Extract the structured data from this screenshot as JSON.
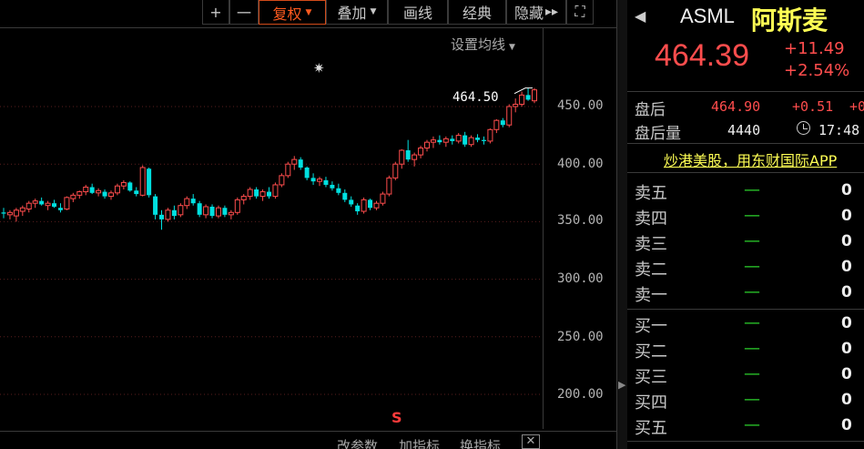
{
  "toolbar": {
    "zoom_in": "+",
    "zoom_out": "一",
    "adjust_label": "复权",
    "overlay_label": "叠加",
    "draw_label": "画线",
    "classic_label": "经典",
    "hide_label": "隐藏",
    "hide_arrows": "▸▸",
    "fullscreen_icon": "⛶"
  },
  "chart": {
    "ma_setting": "设置均线",
    "last_price_label": "464.50",
    "y_ticks": [
      "450.00",
      "400.00",
      "350.00",
      "300.00",
      "250.00",
      "200.00"
    ],
    "s_marker": "S",
    "up_color": "#ff4d4d",
    "down_color": "#00e0e0"
  },
  "chart_data": {
    "type": "candlestick",
    "ylim": [
      180,
      480
    ],
    "candles": [
      {
        "o": 358,
        "h": 362,
        "l": 353,
        "c": 357
      },
      {
        "o": 356,
        "h": 360,
        "l": 352,
        "c": 358
      },
      {
        "o": 355,
        "h": 362,
        "l": 350,
        "c": 360
      },
      {
        "o": 359,
        "h": 364,
        "l": 355,
        "c": 362
      },
      {
        "o": 361,
        "h": 368,
        "l": 358,
        "c": 366
      },
      {
        "o": 366,
        "h": 370,
        "l": 362,
        "c": 368
      },
      {
        "o": 368,
        "h": 371,
        "l": 364,
        "c": 365
      },
      {
        "o": 364,
        "h": 368,
        "l": 360,
        "c": 366
      },
      {
        "o": 366,
        "h": 369,
        "l": 362,
        "c": 363
      },
      {
        "o": 362,
        "h": 366,
        "l": 358,
        "c": 360
      },
      {
        "o": 361,
        "h": 372,
        "l": 360,
        "c": 371
      },
      {
        "o": 370,
        "h": 375,
        "l": 367,
        "c": 373
      },
      {
        "o": 373,
        "h": 377,
        "l": 370,
        "c": 376
      },
      {
        "o": 376,
        "h": 382,
        "l": 373,
        "c": 380
      },
      {
        "o": 380,
        "h": 383,
        "l": 374,
        "c": 375
      },
      {
        "o": 375,
        "h": 379,
        "l": 372,
        "c": 377
      },
      {
        "o": 376,
        "h": 378,
        "l": 370,
        "c": 372
      },
      {
        "o": 372,
        "h": 377,
        "l": 369,
        "c": 375
      },
      {
        "o": 375,
        "h": 383,
        "l": 373,
        "c": 381
      },
      {
        "o": 381,
        "h": 386,
        "l": 378,
        "c": 384
      },
      {
        "o": 384,
        "h": 385,
        "l": 376,
        "c": 377
      },
      {
        "o": 377,
        "h": 380,
        "l": 372,
        "c": 374
      },
      {
        "o": 373,
        "h": 399,
        "l": 372,
        "c": 397
      },
      {
        "o": 396,
        "h": 397,
        "l": 371,
        "c": 373
      },
      {
        "o": 372,
        "h": 374,
        "l": 352,
        "c": 356
      },
      {
        "o": 356,
        "h": 360,
        "l": 343,
        "c": 352
      },
      {
        "o": 352,
        "h": 362,
        "l": 350,
        "c": 360
      },
      {
        "o": 360,
        "h": 364,
        "l": 352,
        "c": 355
      },
      {
        "o": 356,
        "h": 366,
        "l": 354,
        "c": 364
      },
      {
        "o": 364,
        "h": 372,
        "l": 361,
        "c": 370
      },
      {
        "o": 370,
        "h": 374,
        "l": 364,
        "c": 366
      },
      {
        "o": 366,
        "h": 368,
        "l": 354,
        "c": 356
      },
      {
        "o": 356,
        "h": 365,
        "l": 353,
        "c": 363
      },
      {
        "o": 363,
        "h": 365,
        "l": 353,
        "c": 355
      },
      {
        "o": 355,
        "h": 364,
        "l": 353,
        "c": 362
      },
      {
        "o": 362,
        "h": 364,
        "l": 354,
        "c": 356
      },
      {
        "o": 356,
        "h": 360,
        "l": 352,
        "c": 358
      },
      {
        "o": 358,
        "h": 371,
        "l": 356,
        "c": 369
      },
      {
        "o": 369,
        "h": 374,
        "l": 365,
        "c": 372
      },
      {
        "o": 372,
        "h": 380,
        "l": 369,
        "c": 378
      },
      {
        "o": 378,
        "h": 380,
        "l": 370,
        "c": 372
      },
      {
        "o": 372,
        "h": 378,
        "l": 368,
        "c": 376
      },
      {
        "o": 376,
        "h": 380,
        "l": 370,
        "c": 372
      },
      {
        "o": 372,
        "h": 384,
        "l": 370,
        "c": 382
      },
      {
        "o": 382,
        "h": 392,
        "l": 380,
        "c": 390
      },
      {
        "o": 390,
        "h": 402,
        "l": 388,
        "c": 400
      },
      {
        "o": 400,
        "h": 407,
        "l": 395,
        "c": 404
      },
      {
        "o": 404,
        "h": 406,
        "l": 395,
        "c": 397
      },
      {
        "o": 397,
        "h": 398,
        "l": 386,
        "c": 388
      },
      {
        "o": 388,
        "h": 392,
        "l": 382,
        "c": 385
      },
      {
        "o": 385,
        "h": 389,
        "l": 381,
        "c": 387
      },
      {
        "o": 386,
        "h": 389,
        "l": 380,
        "c": 382
      },
      {
        "o": 382,
        "h": 385,
        "l": 377,
        "c": 379
      },
      {
        "o": 379,
        "h": 383,
        "l": 373,
        "c": 375
      },
      {
        "o": 375,
        "h": 378,
        "l": 367,
        "c": 369
      },
      {
        "o": 369,
        "h": 372,
        "l": 363,
        "c": 365
      },
      {
        "o": 364,
        "h": 366,
        "l": 356,
        "c": 359
      },
      {
        "o": 359,
        "h": 371,
        "l": 357,
        "c": 369
      },
      {
        "o": 369,
        "h": 370,
        "l": 360,
        "c": 362
      },
      {
        "o": 362,
        "h": 368,
        "l": 360,
        "c": 366
      },
      {
        "o": 366,
        "h": 376,
        "l": 364,
        "c": 374
      },
      {
        "o": 374,
        "h": 390,
        "l": 372,
        "c": 388
      },
      {
        "o": 388,
        "h": 402,
        "l": 386,
        "c": 400
      },
      {
        "o": 400,
        "h": 413,
        "l": 396,
        "c": 412
      },
      {
        "o": 412,
        "h": 421,
        "l": 402,
        "c": 404
      },
      {
        "o": 404,
        "h": 410,
        "l": 398,
        "c": 408
      },
      {
        "o": 408,
        "h": 416,
        "l": 405,
        "c": 414
      },
      {
        "o": 414,
        "h": 421,
        "l": 411,
        "c": 419
      },
      {
        "o": 419,
        "h": 424,
        "l": 414,
        "c": 421
      },
      {
        "o": 421,
        "h": 425,
        "l": 417,
        "c": 419
      },
      {
        "o": 419,
        "h": 424,
        "l": 415,
        "c": 422
      },
      {
        "o": 422,
        "h": 425,
        "l": 417,
        "c": 420
      },
      {
        "o": 420,
        "h": 427,
        "l": 418,
        "c": 425
      },
      {
        "o": 425,
        "h": 428,
        "l": 415,
        "c": 417
      },
      {
        "o": 417,
        "h": 425,
        "l": 415,
        "c": 423
      },
      {
        "o": 423,
        "h": 426,
        "l": 419,
        "c": 421
      },
      {
        "o": 421,
        "h": 424,
        "l": 417,
        "c": 420
      },
      {
        "o": 420,
        "h": 431,
        "l": 418,
        "c": 430
      },
      {
        "o": 430,
        "h": 439,
        "l": 427,
        "c": 438
      },
      {
        "o": 438,
        "h": 440,
        "l": 432,
        "c": 434
      },
      {
        "o": 434,
        "h": 452,
        "l": 432,
        "c": 450
      },
      {
        "o": 450,
        "h": 457,
        "l": 445,
        "c": 452
      },
      {
        "o": 452,
        "h": 463,
        "l": 450,
        "c": 460
      },
      {
        "o": 460,
        "h": 466,
        "l": 455,
        "c": 456
      },
      {
        "o": 455,
        "h": 466,
        "l": 453,
        "c": 464.5
      }
    ]
  },
  "bottom_bar": {
    "modify_params": "改参数",
    "add_indicator": "加指标",
    "switch_indicator": "换指标",
    "close": "✕"
  },
  "quote": {
    "symbol": "ASML",
    "name": "阿斯麦",
    "price": "464.39",
    "change": "+11.49",
    "change_pct": "+2.54%",
    "after_hours_label": "盘后",
    "after_hours_price": "464.90",
    "after_hours_change": "+0.51",
    "after_hours_pct_partial": "+0",
    "after_hours_vol_label": "盘后量",
    "after_hours_vol": "4440",
    "time": "17:48",
    "promo": "炒港美股，用东财国际APP",
    "asks": [
      {
        "label": "卖五",
        "price": "—",
        "qty": "0"
      },
      {
        "label": "卖四",
        "price": "—",
        "qty": "0"
      },
      {
        "label": "卖三",
        "price": "—",
        "qty": "0"
      },
      {
        "label": "卖二",
        "price": "—",
        "qty": "0"
      },
      {
        "label": "卖一",
        "price": "—",
        "qty": "0"
      }
    ],
    "bids": [
      {
        "label": "买一",
        "price": "—",
        "qty": "0"
      },
      {
        "label": "买二",
        "price": "—",
        "qty": "0"
      },
      {
        "label": "买三",
        "price": "—",
        "qty": "0"
      },
      {
        "label": "买四",
        "price": "—",
        "qty": "0"
      },
      {
        "label": "买五",
        "price": "—",
        "qty": "0"
      }
    ]
  }
}
